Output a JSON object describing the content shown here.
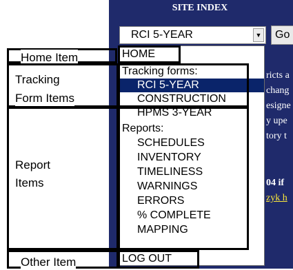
{
  "site_index": {
    "title": "SITE INDEX",
    "selected_value": "RCI 5-YEAR",
    "go_label": "Go"
  },
  "background_fragments": [
    "ricts a",
    "chang",
    "esigne",
    "y upe",
    "tory t",
    "04 if",
    "zyk h"
  ],
  "dropdown": {
    "home": "HOME",
    "tracking_header": "Tracking forms:",
    "tracking_items": [
      "RCI 5-YEAR",
      "CONSTRUCTION",
      "HPMS 3-YEAR"
    ],
    "reports_header": "Reports:",
    "report_items": [
      "SCHEDULES",
      "INVENTORY",
      "TIMELINESS",
      "WARNINGS",
      "ERRORS",
      "% COMPLETE",
      "MAPPING"
    ],
    "other": "LOG OUT"
  },
  "annotations": {
    "home": "Home Item",
    "tracking_line1": "Tracking",
    "tracking_line2": "Form Items",
    "report_line1": "Report",
    "report_line2": "Items",
    "other": "Other Item"
  },
  "colors": {
    "panel": "#1f2a6b",
    "selected_highlight": "#0a246a"
  }
}
